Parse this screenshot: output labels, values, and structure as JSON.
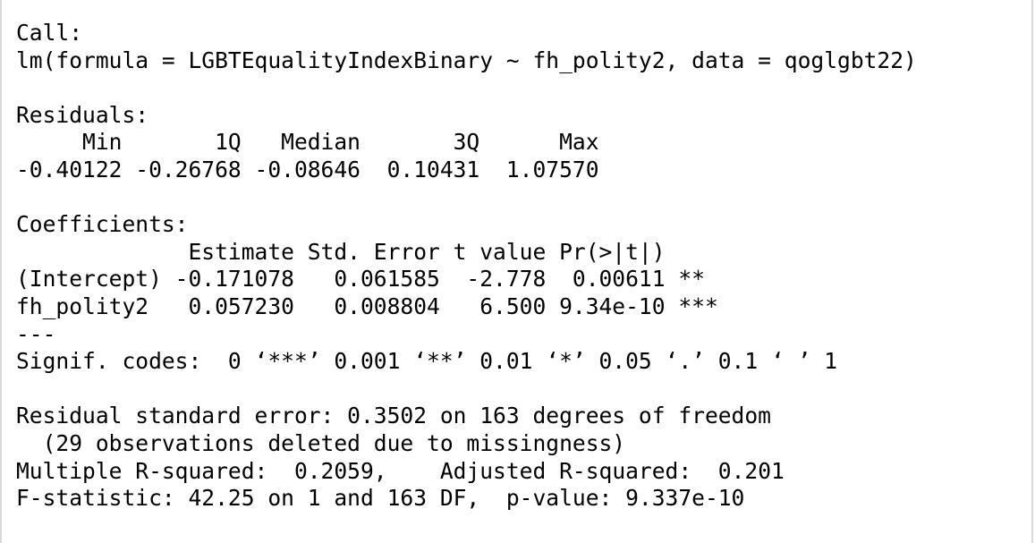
{
  "console": {
    "lines": [
      "Call:",
      "lm(formula = LGBTEqualityIndexBinary ~ fh_polity2, data = qoglgbt22)",
      "",
      "Residuals:",
      "     Min       1Q   Median       3Q      Max ",
      "-0.40122 -0.26768 -0.08646  0.10431  1.07570 ",
      "",
      "Coefficients:",
      "             Estimate Std. Error t value Pr(>|t|)    ",
      "(Intercept) -0.171078   0.061585  -2.778  0.00611 ** ",
      "fh_polity2   0.057230   0.008804   6.500 9.34e-10 ***",
      "---",
      "Signif. codes:  0 ‘***’ 0.001 ‘**’ 0.01 ‘*’ 0.05 ‘.’ 0.1 ‘ ’ 1",
      "",
      "Residual standard error: 0.3502 on 163 degrees of freedom",
      "  (29 observations deleted due to missingness)",
      "Multiple R-squared:  0.2059,\tAdjusted R-squared:  0.201 ",
      "F-statistic: 42.25 on 1 and 163 DF,  p-value: 9.337e-10"
    ]
  }
}
